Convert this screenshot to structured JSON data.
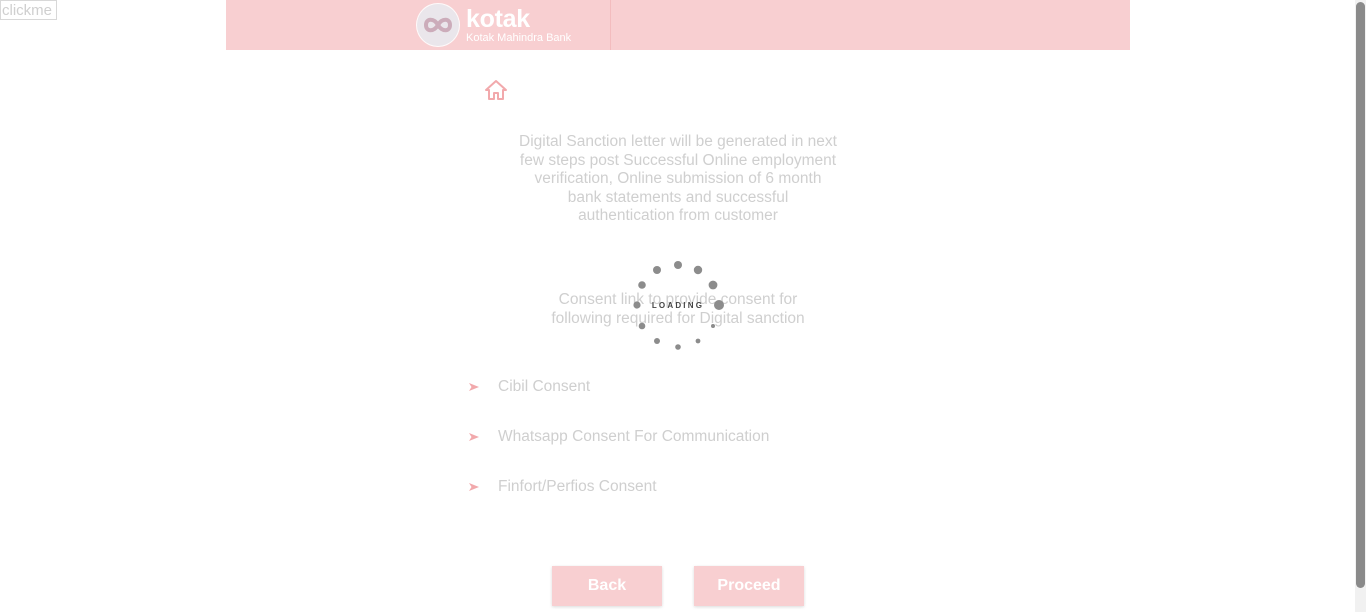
{
  "debug": {
    "clickme_label": "clickme"
  },
  "header": {
    "brand": "kotak",
    "sub_brand": "Kotak Mahindra Bank",
    "background": "#f8cfd1"
  },
  "icons": {
    "home": "home-icon",
    "arrow": "arrow-right-icon",
    "loader": "spinner-icon"
  },
  "main": {
    "description": "Digital Sanction letter will be generated in next few steps post Successful Online employment verification, Online submission of 6 month bank statements and successful authentication from customer",
    "consent_title": "Consent link to provide consent for following required for Digital sanction",
    "consents": [
      {
        "label": "Cibil Consent"
      },
      {
        "label": "Whatsapp Consent For Communication"
      },
      {
        "label": "Finfort/Perfios Consent"
      }
    ]
  },
  "loader": {
    "text": "LOADING"
  },
  "actions": {
    "back_label": "Back",
    "proceed_label": "Proceed"
  },
  "colors": {
    "accent": "#f8cfd1",
    "faded_text": "#cfcfcf",
    "arrow": "#f2a9ac"
  }
}
